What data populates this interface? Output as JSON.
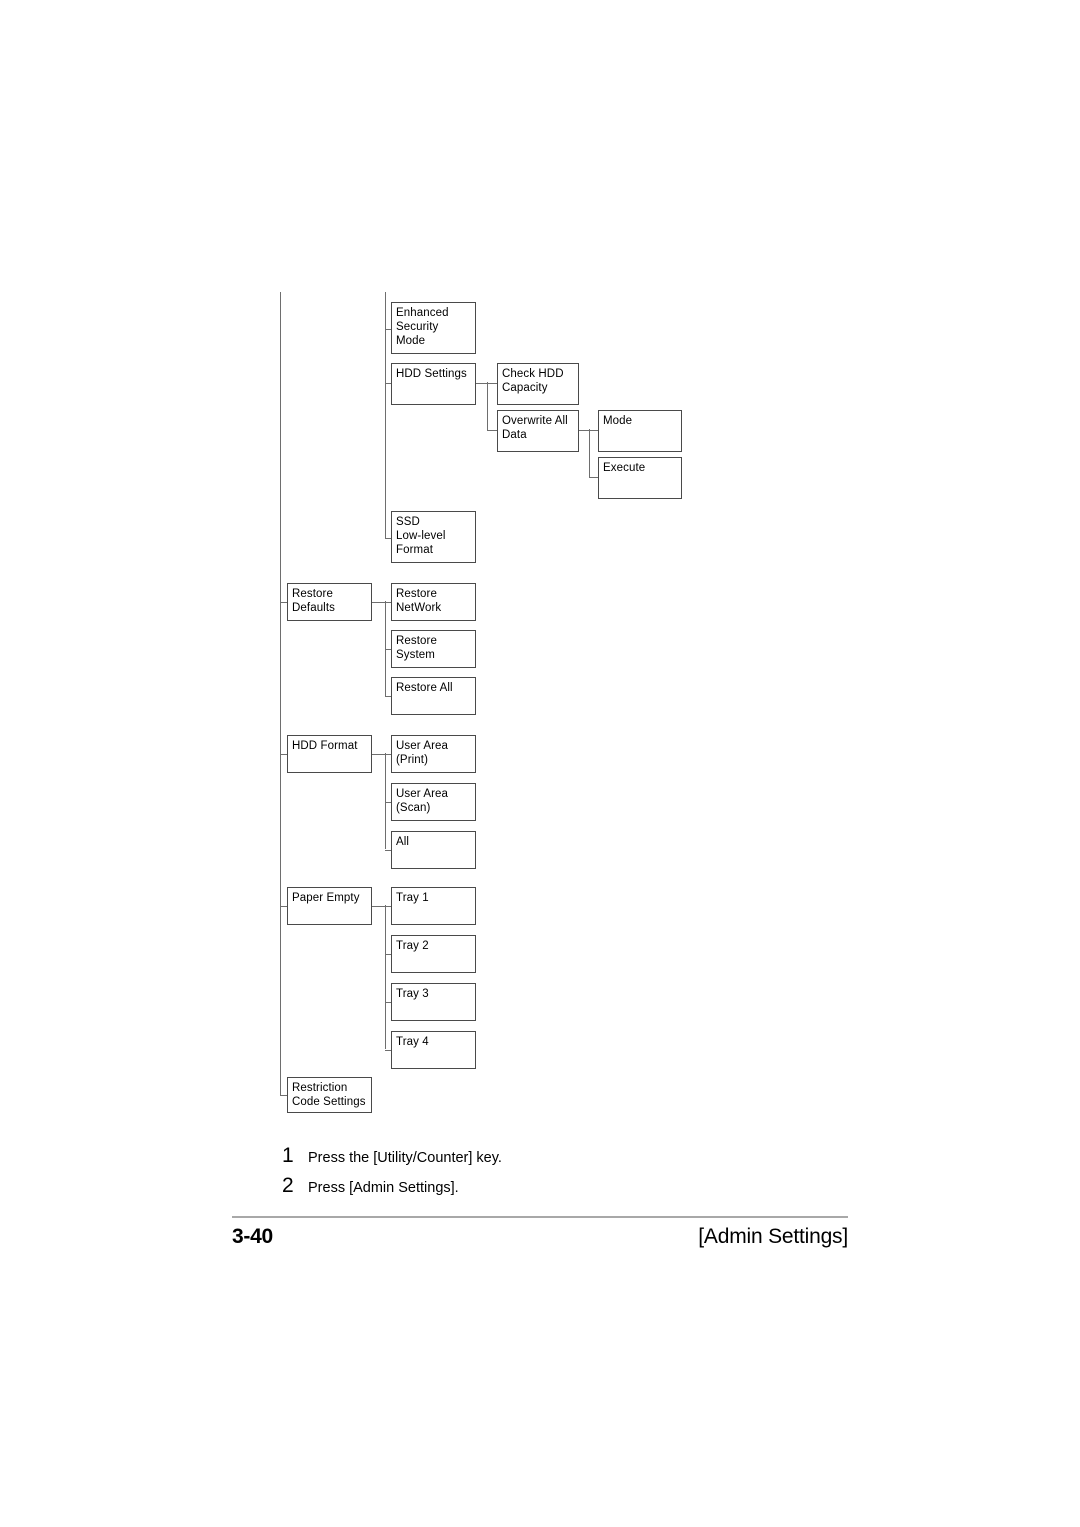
{
  "page": {
    "number": "3-40",
    "footer_title": "[Admin Settings]"
  },
  "steps": [
    {
      "number": "1",
      "text": "Press the [Utility/Counter] key."
    },
    {
      "number": "2",
      "text": "Press [Admin Settings]."
    }
  ],
  "diagram": {
    "type": "menu-tree",
    "nodes": {
      "enhanced_security_mode": "Enhanced\nSecurity\nMode",
      "hdd_settings": "HDD Settings",
      "check_hdd_capacity": "Check HDD\nCapacity",
      "overwrite_all_data": "Overwrite All\nData",
      "mode": "Mode",
      "execute": "Execute",
      "ssd_low_level_format": "SSD\nLow-level\nFormat",
      "restore_defaults": "Restore\nDefaults",
      "restore_network": "Restore\nNetWork",
      "restore_system": "Restore\nSystem",
      "restore_all": "Restore All",
      "hdd_format": "HDD Format",
      "user_area_print": "User Area\n(Print)",
      "user_area_scan": "User Area\n(Scan)",
      "all": "All",
      "paper_empty": "Paper Empty",
      "tray_1": "Tray 1",
      "tray_2": "Tray 2",
      "tray_3": "Tray 3",
      "tray_4": "Tray 4",
      "restriction_code_settings": "Restriction\nCode Settings"
    },
    "colors": {
      "box_border": "#4a4a4a",
      "connector": "#6e6e6e",
      "footer_rule": "#a8a8a8",
      "text": "#000000",
      "background": "#ffffff"
    }
  }
}
